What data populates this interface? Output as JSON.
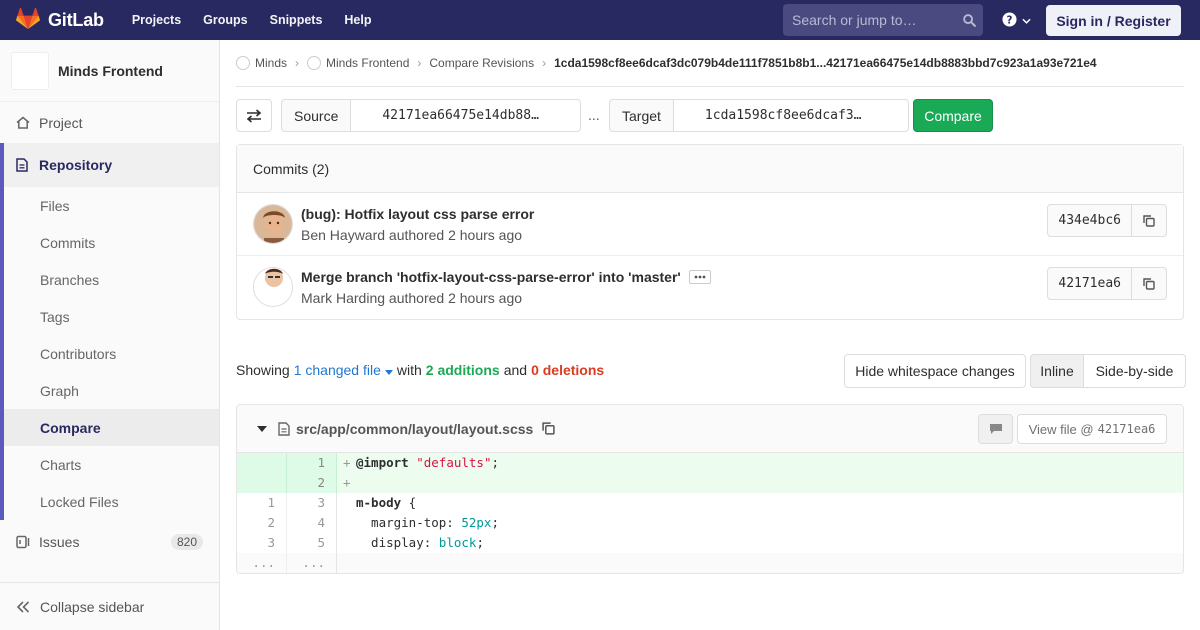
{
  "navbar": {
    "brand": "GitLab",
    "links": [
      "Projects",
      "Groups",
      "Snippets",
      "Help"
    ],
    "search_placeholder": "Search or jump to…",
    "signin_label": "Sign in / Register"
  },
  "sidebar": {
    "project_name": "Minds Frontend",
    "project_label": "Project",
    "repository_label": "Repository",
    "repo_items": [
      "Files",
      "Commits",
      "Branches",
      "Tags",
      "Contributors",
      "Graph",
      "Compare",
      "Charts",
      "Locked Files"
    ],
    "active_item": "Compare",
    "issues_label": "Issues",
    "issues_count": "820",
    "collapse_label": "Collapse sidebar"
  },
  "breadcrumbs": {
    "items": [
      "Minds",
      "Minds Frontend",
      "Compare Revisions"
    ],
    "current": "1cda1598cf8ee6dcaf3dc079b4de111f7851b8b1...42171ea66475e14db8883bbd7c923a1a93e721e4"
  },
  "compare": {
    "source_label": "Source",
    "source_value": "42171ea66475e14db88…",
    "separator": "...",
    "target_label": "Target",
    "target_value": "1cda1598cf8ee6dcaf3…",
    "compare_label": "Compare"
  },
  "commits": {
    "header": "Commits (2)",
    "items": [
      {
        "title": "(bug): Hotfix layout css parse error",
        "author": "Ben Hayward",
        "meta_suffix": " authored 2 hours ago",
        "sha": "434e4bc6",
        "has_ellipsis": false
      },
      {
        "title": "Merge branch 'hotfix-layout-css-parse-error' into 'master'",
        "author": "Mark Harding",
        "meta_suffix": " authored 2 hours ago",
        "sha": "42171ea6",
        "has_ellipsis": true
      }
    ]
  },
  "summary": {
    "showing": "Showing",
    "changed": "1 changed file",
    "with": "with",
    "additions": "2 additions",
    "and": "and",
    "deletions": "0 deletions"
  },
  "view_controls": {
    "whitespace_label": "Hide whitespace changes",
    "inline_label": "Inline",
    "side_label": "Side-by-side"
  },
  "diff": {
    "file_path": "src/app/common/layout/layout.scss",
    "view_file_prefix": "View file @",
    "view_file_sha": "42171ea6",
    "lines": [
      {
        "old": "",
        "new": "1",
        "type": "add"
      },
      {
        "old": "",
        "new": "2",
        "type": "add"
      },
      {
        "old": "1",
        "new": "3",
        "type": "ctx"
      },
      {
        "old": "2",
        "new": "4",
        "type": "ctx"
      },
      {
        "old": "3",
        "new": "5",
        "type": "ctx"
      },
      {
        "old": "...",
        "new": "...",
        "type": "exp"
      }
    ],
    "code": {
      "l1_kw": "@import",
      "l1_str": "\"defaults\"",
      "l1_end": ";",
      "l3_sel": "m-body",
      "l3_end": " {",
      "l4_prop": "  margin-top: ",
      "l4_val": "52px",
      "l4_end": ";",
      "l5_prop": "  display: ",
      "l5_val": "block",
      "l5_end": ";"
    }
  },
  "colors": {
    "navbar": "#292961",
    "accent": "#5b5bbd",
    "success": "#1aaa55",
    "danger": "#db3b21",
    "link": "#1f78d1"
  }
}
